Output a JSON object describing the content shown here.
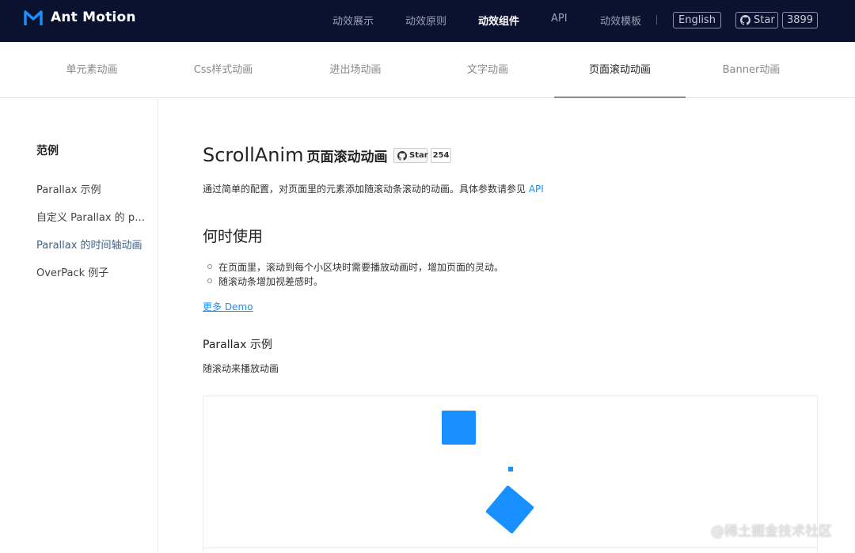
{
  "header": {
    "brand": "Ant Motion",
    "nav": [
      "动效展示",
      "动效原则",
      "动效组件",
      "API",
      "动效模板"
    ],
    "active_nav": "动效组件",
    "language_button": "English",
    "star_label": "Star",
    "star_count": "3899"
  },
  "subnav": {
    "items": [
      "单元素动画",
      "Css样式动画",
      "进出场动画",
      "文字动画",
      "页面滚动动画",
      "Banner动画"
    ],
    "active": "页面滚动动画"
  },
  "sidebar": {
    "title": "范例",
    "items": [
      "Parallax 示例",
      "自定义 Parallax 的 playScale",
      "Parallax 的时间轴动画",
      "OverPack 例子"
    ],
    "active": "Parallax 的时间轴动画"
  },
  "main": {
    "title_en": "ScrollAnim",
    "title_cn": "页面滚动动画",
    "github_badge": {
      "label": "Star",
      "count": "254"
    },
    "intro_text": "通过简单的配置，对页面里的元素添加随滚动条滚动的动画。具体参数请参见",
    "intro_link": "API",
    "section_title": "何时使用",
    "bullets": [
      "在页面里，滚动到每个小区块时需要播放动画时，增加页面的灵动。",
      "随滚动条增加视差感时。"
    ],
    "more_demo": "更多 Demo",
    "example_title": "Parallax 示例",
    "example_desc": "随滚动来播放动画"
  },
  "colors": {
    "header_bg": "#0b1230",
    "accent": "#1890ff",
    "logo": "#1890ff"
  },
  "watermark": "@稀土掘金技术社区"
}
